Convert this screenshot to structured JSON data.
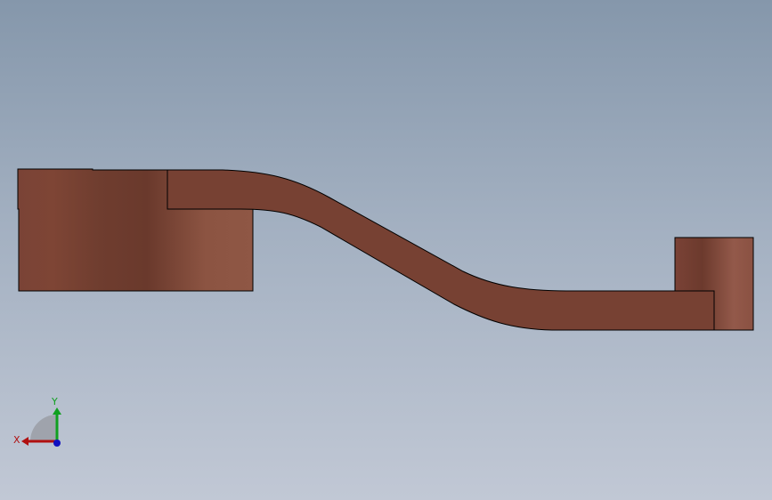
{
  "viewport": {
    "background_top": "#8597ab",
    "background_bottom": "#c1c8d5"
  },
  "part": {
    "color_dark": "#6e3c2e",
    "color_mid": "#7a4234",
    "color_light": "#93584a",
    "edge_color": "#000000"
  },
  "triad": {
    "x_label": "X",
    "y_label": "Y",
    "x_color": "#b01010",
    "y_color": "#10a020",
    "z_color": "#1010c0",
    "icon": "coordinate-triad-icon"
  }
}
